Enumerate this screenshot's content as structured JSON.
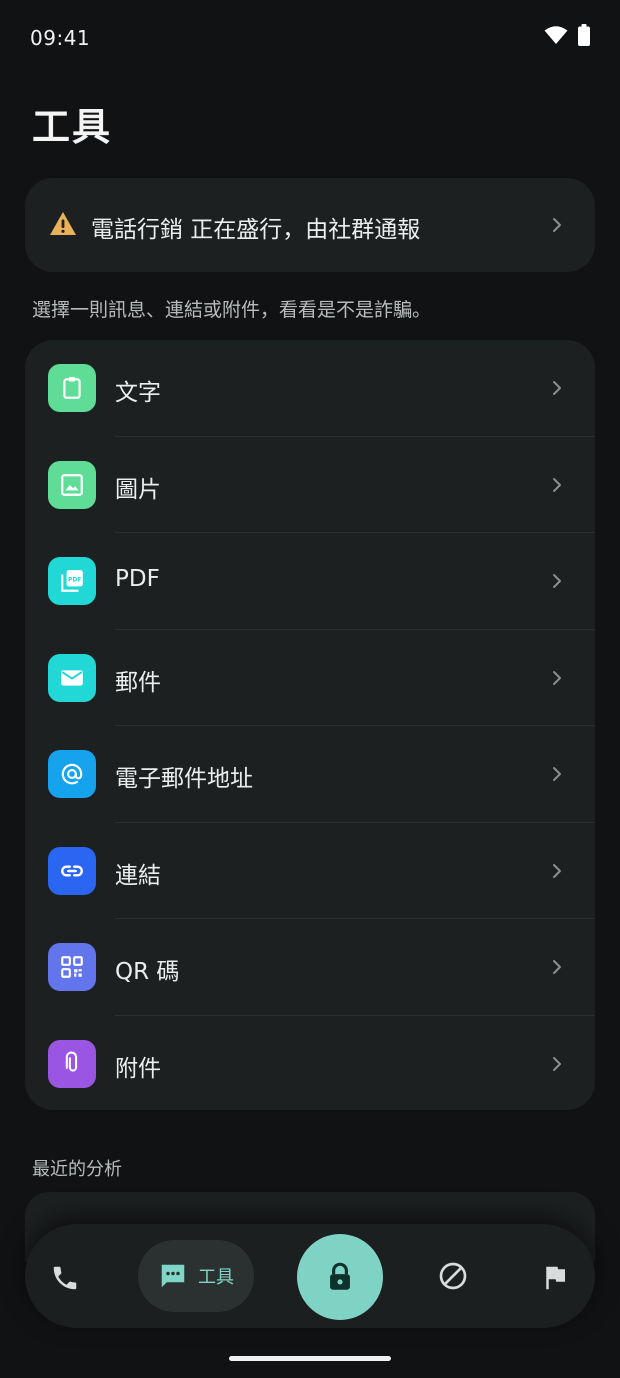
{
  "status_bar": {
    "time": "09:41",
    "icons": [
      "wifi-icon",
      "battery-icon"
    ]
  },
  "page": {
    "title": "工具"
  },
  "alert": {
    "icon": "warning-icon",
    "text": "電話行銷 正在盛行，由社群通報"
  },
  "hint": "選擇一則訊息、連結或附件，看看是不是詐騙。",
  "tools": [
    {
      "label": "文字",
      "icon": "clipboard-icon",
      "color": "#5fdc96"
    },
    {
      "label": "圖片",
      "icon": "image-icon",
      "color": "#5fdc96"
    },
    {
      "label": "PDF",
      "icon": "pdf-icon",
      "color": "#22d8d6"
    },
    {
      "label": "郵件",
      "icon": "mail-icon",
      "color": "#22d8d6"
    },
    {
      "label": "電子郵件地址",
      "icon": "at-icon",
      "color": "#16a3ee"
    },
    {
      "label": "連結",
      "icon": "link-icon",
      "color": "#2a66f2"
    },
    {
      "label": "QR 碼",
      "icon": "qr-code-icon",
      "color": "#6275ec"
    },
    {
      "label": "附件",
      "icon": "paperclip-icon",
      "color": "#9a55e3"
    }
  ],
  "recent": {
    "title": "最近的分析"
  },
  "bottom_nav": {
    "items": [
      {
        "name": "phone",
        "icon": "phone-icon"
      },
      {
        "name": "tools",
        "icon": "chat-icon",
        "label": "工具",
        "active": true
      },
      {
        "name": "lock",
        "icon": "lock-icon"
      },
      {
        "name": "block",
        "icon": "block-icon"
      },
      {
        "name": "flag",
        "icon": "flag-icon"
      }
    ]
  },
  "colors": {
    "background": "#111213",
    "card": "#1d2021",
    "accent": "#7fd3c4",
    "warning": "#e8b25a"
  }
}
